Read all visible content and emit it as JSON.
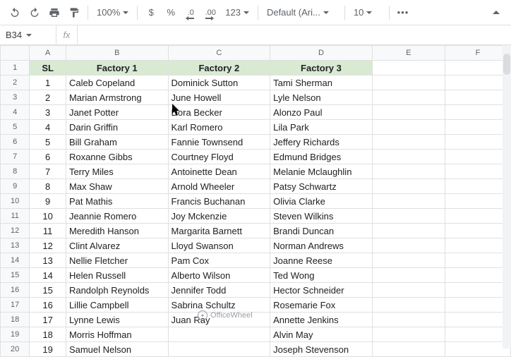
{
  "toolbar": {
    "zoom": "100%",
    "currency": "$",
    "percent": "%",
    "dec_dec": ".0",
    "inc_dec": ".00",
    "more_fmt": "123",
    "font": "Default (Ari...",
    "font_size": "10",
    "more": "•••"
  },
  "namebox": "B34",
  "fx_label": "fx",
  "columns": [
    "A",
    "B",
    "C",
    "D",
    "E",
    "F"
  ],
  "headers": {
    "A": "SL",
    "B": "Factory 1",
    "C": "Factory 2",
    "D": "Factory 3"
  },
  "rows": [
    {
      "n": 1,
      "sl": "1",
      "b": "Caleb Copeland",
      "c": "Dominick Sutton",
      "d": "Tami Sherman"
    },
    {
      "n": 2,
      "sl": "2",
      "b": "Marian Armstrong",
      "c": "June Howell",
      "d": "Lyle Nelson"
    },
    {
      "n": 3,
      "sl": "3",
      "b": "Janet Potter",
      "c": "Dora Becker",
      "d": "Alonzo Paul"
    },
    {
      "n": 4,
      "sl": "4",
      "b": "Darin Griffin",
      "c": "Karl Romero",
      "d": "Lila Park"
    },
    {
      "n": 5,
      "sl": "5",
      "b": "Bill Graham",
      "c": "Fannie Townsend",
      "d": "Jeffery Richards"
    },
    {
      "n": 6,
      "sl": "6",
      "b": "Roxanne Gibbs",
      "c": "Courtney Floyd",
      "d": "Edmund Bridges"
    },
    {
      "n": 7,
      "sl": "7",
      "b": "Terry Miles",
      "c": "Antoinette Dean",
      "d": "Melanie Mclaughlin"
    },
    {
      "n": 8,
      "sl": "8",
      "b": "Max Shaw",
      "c": "Arnold Wheeler",
      "d": "Patsy Schwartz"
    },
    {
      "n": 9,
      "sl": "9",
      "b": "Pat Mathis",
      "c": "Francis Buchanan",
      "d": "Olivia Clarke"
    },
    {
      "n": 10,
      "sl": "10",
      "b": "Jeannie Romero",
      "c": "Joy Mckenzie",
      "d": "Steven Wilkins"
    },
    {
      "n": 11,
      "sl": "11",
      "b": "Meredith Hanson",
      "c": "Margarita Barnett",
      "d": "Brandi Duncan"
    },
    {
      "n": 12,
      "sl": "12",
      "b": "Clint Alvarez",
      "c": "Lloyd Swanson",
      "d": "Norman Andrews"
    },
    {
      "n": 13,
      "sl": "13",
      "b": "Nellie Fletcher",
      "c": "Pam Cox",
      "d": "Joanne Reese"
    },
    {
      "n": 14,
      "sl": "14",
      "b": "Helen Russell",
      "c": "Alberto Wilson",
      "d": "Ted Wong"
    },
    {
      "n": 15,
      "sl": "15",
      "b": "Randolph Reynolds",
      "c": "Jennifer Todd",
      "d": "Hector Schneider"
    },
    {
      "n": 16,
      "sl": "16",
      "b": "Lillie Campbell",
      "c": "Sabrina Schultz",
      "d": "Rosemarie Fox"
    },
    {
      "n": 17,
      "sl": "17",
      "b": "Lynne Lewis",
      "c": "Juan Ray",
      "d": "Annette Jenkins"
    },
    {
      "n": 18,
      "sl": "18",
      "b": "Morris Hoffman",
      "c": "",
      "d": "Alvin May"
    },
    {
      "n": 19,
      "sl": "19",
      "b": "Samuel Nelson",
      "c": "",
      "d": "Joseph Stevenson"
    }
  ],
  "watermark": "OfficeWheel"
}
